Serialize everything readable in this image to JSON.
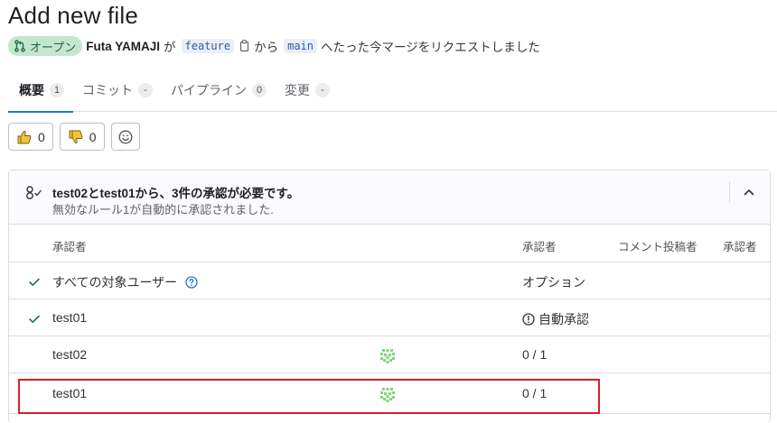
{
  "header": {
    "title": "Add new file",
    "status_badge": "オープン",
    "author": "Futa YAMAJI",
    "text_ga": "が",
    "source_branch": "feature",
    "text_kara": "から",
    "target_branch": "main",
    "text_tail": "へたった今マージをリクエストしました"
  },
  "tabs": [
    {
      "label": "概要",
      "count": "1"
    },
    {
      "label": "コミット",
      "count": "-"
    },
    {
      "label": "パイプライン",
      "count": "0"
    },
    {
      "label": "変更",
      "count": "-"
    }
  ],
  "reactions": {
    "thumbsup_count": "0",
    "thumbsdown_count": "0"
  },
  "approvals": {
    "title": "test02とtest01から、3件の承認が必要です。",
    "subtitle": "無効なルール1が自動的に承認されました.",
    "columns": {
      "approver": "承認者",
      "approvals": "承認者",
      "commented_by": "コメント投稿者",
      "approved_by": "承認者"
    },
    "rows": [
      {
        "name": "すべての対象ユーザー",
        "status": "オプション"
      },
      {
        "name": "test01",
        "status": "自動承認"
      },
      {
        "name": "test02",
        "status": "0 / 1"
      },
      {
        "name": "test01",
        "status": "0 / 1"
      }
    ]
  },
  "colors": {
    "accent": "#1f75cb",
    "open_badge_bg": "#c3e6cd",
    "open_badge_fg": "#24663b",
    "check": "#217645",
    "highlight": "#d9202a"
  }
}
